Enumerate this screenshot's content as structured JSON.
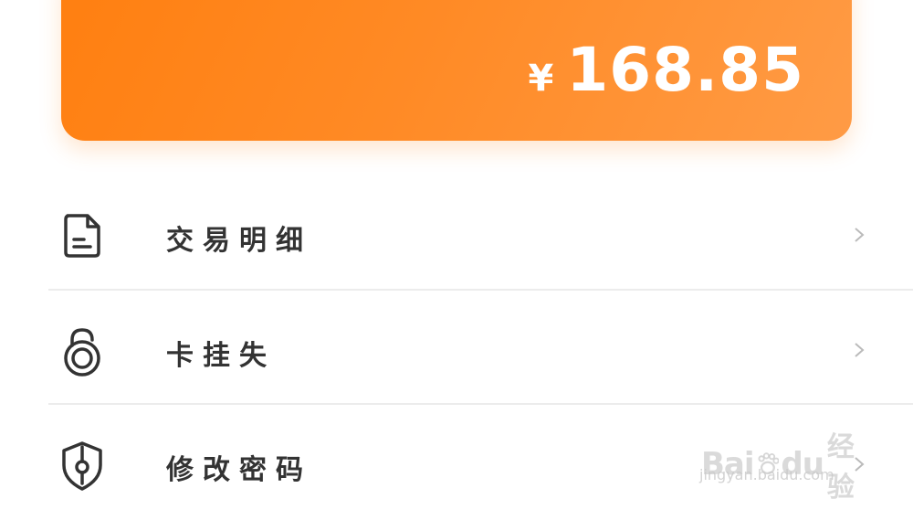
{
  "balance": {
    "currency": "¥",
    "amount": "168.85"
  },
  "menu": {
    "items": [
      {
        "label": "交易明细",
        "icon": "document-icon"
      },
      {
        "label": "卡挂失",
        "icon": "lock-icon"
      },
      {
        "label": "修改密码",
        "icon": "shield-icon"
      }
    ]
  },
  "watermark": {
    "brand_left": "Bai",
    "brand_right": "du",
    "brand_cn": "经验",
    "url": "jingyan.baidu.com"
  },
  "colors": {
    "accent": "#ff8a25",
    "text": "#333333",
    "divider": "#ececec"
  }
}
